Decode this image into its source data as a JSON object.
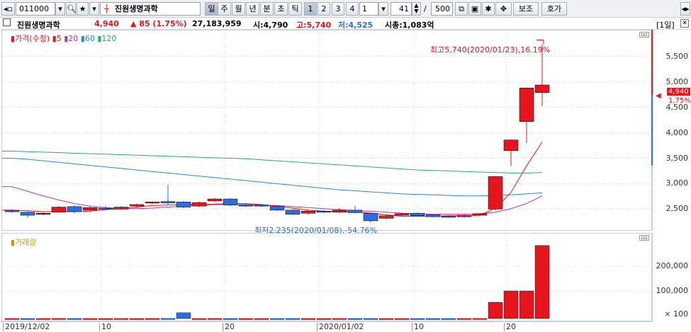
{
  "toolbar": {
    "code_value": "011000",
    "stock_name": "진원생명과학",
    "periods": [
      "일",
      "주",
      "월",
      "년",
      "분",
      "초",
      "틱"
    ],
    "active_period": "일",
    "numbers": [
      "1",
      "2",
      "3",
      "4"
    ],
    "interval_value": "1",
    "count_value": "41",
    "slash": "/",
    "total_value": "500",
    "aux_label": "보조",
    "quote_label": "호가",
    "period_tab": "[1일]"
  },
  "info": {
    "name": "진원생명과학",
    "price": "4,940",
    "change": "▲ 85 (1.75%)",
    "volume": "27,183,959",
    "open": "시:4,790",
    "high": "고:5,740",
    "low": "저:4,525",
    "mktcap": "시총:1,083억"
  },
  "price_panel": {
    "legend_price": "가격(수정)",
    "legend_ma": [
      "5",
      "20",
      "60",
      "120"
    ],
    "high_annotation": "최고5,740(2020/01/23),16.19%",
    "low_annotation": "최저2,235(2020/01/08),-54.76%",
    "current_price_tag": "4,940",
    "current_pct": "1.75%",
    "y_ticks": [
      "5,500",
      "5,000",
      "4,500",
      "4,000",
      "3,500",
      "3,000",
      "2,500"
    ]
  },
  "volume_panel": {
    "legend": "거래량",
    "y_ticks": [
      "200,000",
      "100,000",
      "× 100"
    ]
  },
  "x_axis": {
    "labels": [
      "2019/12/02",
      "10",
      "20",
      "2020/01/02",
      "10",
      "20"
    ]
  },
  "colors": {
    "up": "#e8141c",
    "down": "#2a6fdb",
    "ma5": "#e8141c",
    "ma20": "#b03aa8",
    "ma60": "#2a8ad6",
    "ma120": "#2aa87f"
  },
  "chart_data": {
    "type": "candlestick",
    "candles": [
      {
        "o": 2470,
        "h": 2500,
        "l": 2430,
        "c": 2460
      },
      {
        "o": 2440,
        "h": 2460,
        "l": 2330,
        "c": 2380
      },
      {
        "o": 2400,
        "h": 2440,
        "l": 2380,
        "c": 2420
      },
      {
        "o": 2440,
        "h": 2560,
        "l": 2430,
        "c": 2540
      },
      {
        "o": 2550,
        "h": 2580,
        "l": 2420,
        "c": 2450
      },
      {
        "o": 2480,
        "h": 2560,
        "l": 2450,
        "c": 2530
      },
      {
        "o": 2520,
        "h": 2560,
        "l": 2480,
        "c": 2500
      },
      {
        "o": 2500,
        "h": 2560,
        "l": 2490,
        "c": 2540
      },
      {
        "o": 2560,
        "h": 2610,
        "l": 2540,
        "c": 2590
      },
      {
        "o": 2620,
        "h": 2650,
        "l": 2600,
        "c": 2640
      },
      {
        "o": 2650,
        "h": 2980,
        "l": 2580,
        "c": 2620
      },
      {
        "o": 2640,
        "h": 2660,
        "l": 2520,
        "c": 2540
      },
      {
        "o": 2560,
        "h": 2650,
        "l": 2540,
        "c": 2630
      },
      {
        "o": 2660,
        "h": 2720,
        "l": 2640,
        "c": 2700
      },
      {
        "o": 2700,
        "h": 2720,
        "l": 2560,
        "c": 2580
      },
      {
        "o": 2580,
        "h": 2600,
        "l": 2540,
        "c": 2570
      },
      {
        "o": 2580,
        "h": 2600,
        "l": 2540,
        "c": 2560
      },
      {
        "o": 2560,
        "h": 2570,
        "l": 2460,
        "c": 2480
      },
      {
        "o": 2480,
        "h": 2500,
        "l": 2380,
        "c": 2400
      },
      {
        "o": 2420,
        "h": 2480,
        "l": 2390,
        "c": 2460
      },
      {
        "o": 2460,
        "h": 2480,
        "l": 2420,
        "c": 2440
      },
      {
        "o": 2440,
        "h": 2520,
        "l": 2420,
        "c": 2480
      },
      {
        "o": 2480,
        "h": 2560,
        "l": 2420,
        "c": 2430
      },
      {
        "o": 2420,
        "h": 2440,
        "l": 2235,
        "c": 2270
      },
      {
        "o": 2320,
        "h": 2380,
        "l": 2300,
        "c": 2370
      },
      {
        "o": 2380,
        "h": 2420,
        "l": 2360,
        "c": 2410
      },
      {
        "o": 2420,
        "h": 2440,
        "l": 2360,
        "c": 2370
      },
      {
        "o": 2390,
        "h": 2400,
        "l": 2340,
        "c": 2350
      },
      {
        "o": 2360,
        "h": 2380,
        "l": 2330,
        "c": 2340
      },
      {
        "o": 2350,
        "h": 2400,
        "l": 2330,
        "c": 2380
      },
      {
        "o": 2380,
        "h": 2420,
        "l": 2360,
        "c": 2410
      },
      {
        "o": 2500,
        "h": 3150,
        "l": 2480,
        "c": 3140
      },
      {
        "o": 3650,
        "h": 3870,
        "l": 3350,
        "c": 3860
      },
      {
        "o": 4220,
        "h": 4890,
        "l": 3800,
        "c": 4880
      },
      {
        "o": 4790,
        "h": 5740,
        "l": 4525,
        "c": 4940
      }
    ],
    "volumes": [
      3,
      2,
      2,
      4,
      3,
      2,
      2,
      3,
      2,
      3,
      4,
      3,
      2,
      3,
      2,
      2,
      2,
      2,
      3,
      2,
      2,
      3,
      2,
      3,
      2,
      2,
      2,
      2,
      2,
      3,
      4,
      620,
      1050,
      1050,
      2780
    ],
    "volume_down": [
      false,
      true,
      false,
      false,
      true,
      false,
      false,
      false,
      false,
      false,
      true,
      true,
      false,
      false,
      true,
      false,
      false,
      true,
      true,
      false,
      false,
      false,
      true,
      true,
      false,
      false,
      true,
      true,
      true,
      false,
      false,
      false,
      false,
      false,
      false
    ],
    "big_blue_volume_index": 11,
    "big_blue_volume": 220,
    "ma120": [
      3640,
      3630,
      3620,
      3610,
      3600,
      3590,
      3580,
      3570,
      3560,
      3550,
      3540,
      3530,
      3520,
      3510,
      3500,
      3490,
      3470,
      3450,
      3430,
      3410,
      3390,
      3370,
      3350,
      3330,
      3310,
      3290,
      3270,
      3260,
      3250,
      3240,
      3230,
      3220,
      3210,
      3210,
      3220
    ],
    "ma60": [
      3500,
      3480,
      3450,
      3420,
      3390,
      3360,
      3330,
      3300,
      3270,
      3240,
      3210,
      3180,
      3150,
      3120,
      3090,
      3060,
      3030,
      3000,
      2970,
      2940,
      2910,
      2880,
      2860,
      2840,
      2820,
      2800,
      2790,
      2780,
      2770,
      2760,
      2760,
      2770,
      2780,
      2800,
      2820
    ],
    "ma20": [
      2940,
      2850,
      2760,
      2680,
      2610,
      2560,
      2530,
      2510,
      2510,
      2520,
      2540,
      2560,
      2580,
      2590,
      2590,
      2590,
      2580,
      2570,
      2550,
      2530,
      2510,
      2490,
      2470,
      2460,
      2440,
      2420,
      2410,
      2400,
      2400,
      2400,
      2410,
      2440,
      2510,
      2610,
      2760
    ],
    "ma5": [
      2480,
      2470,
      2450,
      2450,
      2450,
      2460,
      2490,
      2510,
      2540,
      2570,
      2580,
      2590,
      2590,
      2600,
      2610,
      2610,
      2590,
      2560,
      2520,
      2480,
      2460,
      2450,
      2450,
      2420,
      2390,
      2360,
      2360,
      2360,
      2370,
      2370,
      2380,
      2520,
      2830,
      3350,
      3820
    ],
    "ylim": [
      2200,
      5900
    ],
    "volume_ylim": [
      0,
      2800
    ]
  }
}
